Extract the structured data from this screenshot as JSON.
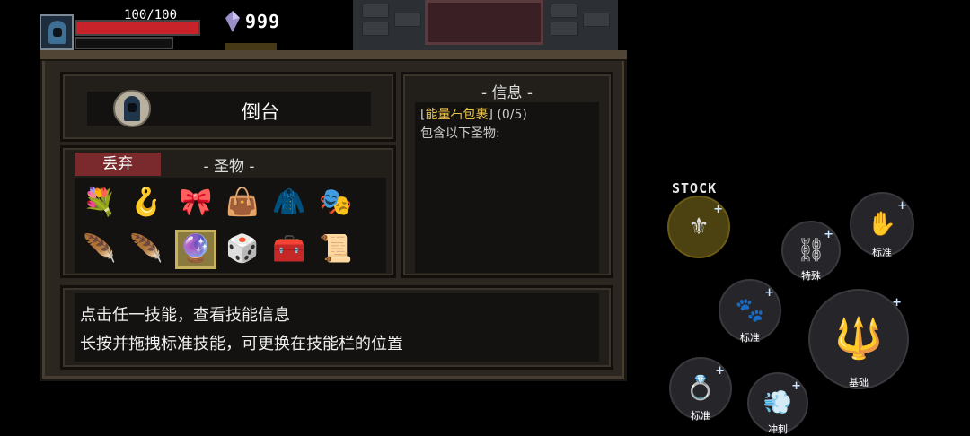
{
  "hud": {
    "hp_text": "100/100",
    "hp_fraction": 1.0,
    "gem_count": "999",
    "colors": {
      "hp": "#c8232b",
      "gem": "#9a8fc9"
    }
  },
  "character": {
    "name": "倒台",
    "avatar_icon": "hooded-rogue-icon"
  },
  "relics": {
    "discard_label": "丢弃",
    "title": "- 圣物 -",
    "items": [
      {
        "icon": "wizard-bouquet-icon",
        "glyph": "💐"
      },
      {
        "icon": "cane-bomb-icon",
        "glyph": "🪝"
      },
      {
        "icon": "bone-bow-icon",
        "glyph": "🎀"
      },
      {
        "icon": "bag-icon",
        "glyph": "👜"
      },
      {
        "icon": "blue-cloak-icon",
        "glyph": "🧥"
      },
      {
        "icon": "silver-mask-icon",
        "glyph": "🎭"
      },
      {
        "icon": "grey-feather-icon",
        "glyph": "🪶"
      },
      {
        "icon": "blue-feather-icon",
        "glyph": "🪶"
      },
      {
        "icon": "energy-gem-bundle-icon",
        "glyph": "🔮",
        "selected": true
      },
      {
        "icon": "dice-card-icon",
        "glyph": "🎲"
      },
      {
        "icon": "treasure-chest-icon",
        "glyph": "🧰"
      },
      {
        "icon": "golden-scroll-icon",
        "glyph": "📜"
      }
    ]
  },
  "info": {
    "title": "- 信息 -",
    "bracket_open": "[",
    "item_name": "能量石包裹",
    "bracket_close": "]",
    "count": "(0/5)",
    "desc": "包含以下圣物:"
  },
  "tips": {
    "line1": "点击任一技能，查看技能信息",
    "line2": "长按并拖拽标准技能，可更换在技能栏的位置"
  },
  "skills": {
    "stock_label": "STOCK",
    "plus": "+",
    "items": [
      {
        "id": "stock",
        "label": "",
        "icon": "golden-claw-icon",
        "glyph": "⚜"
      },
      {
        "id": "special",
        "label": "特殊",
        "icon": "chain-ring-icon",
        "glyph": "⛓"
      },
      {
        "id": "standard-1",
        "label": "标准",
        "icon": "wooden-hand-icon",
        "glyph": "✋"
      },
      {
        "id": "standard-2",
        "label": "标准",
        "icon": "purple-claw-icon",
        "glyph": "🐾"
      },
      {
        "id": "basic",
        "label": "基础",
        "icon": "purple-staff-icon",
        "glyph": "🔱"
      },
      {
        "id": "standard-3",
        "label": "标准",
        "icon": "gold-rings-icon",
        "glyph": "💍"
      },
      {
        "id": "dash",
        "label": "冲刺",
        "icon": "ring-dash-icon",
        "glyph": "💨"
      }
    ]
  }
}
